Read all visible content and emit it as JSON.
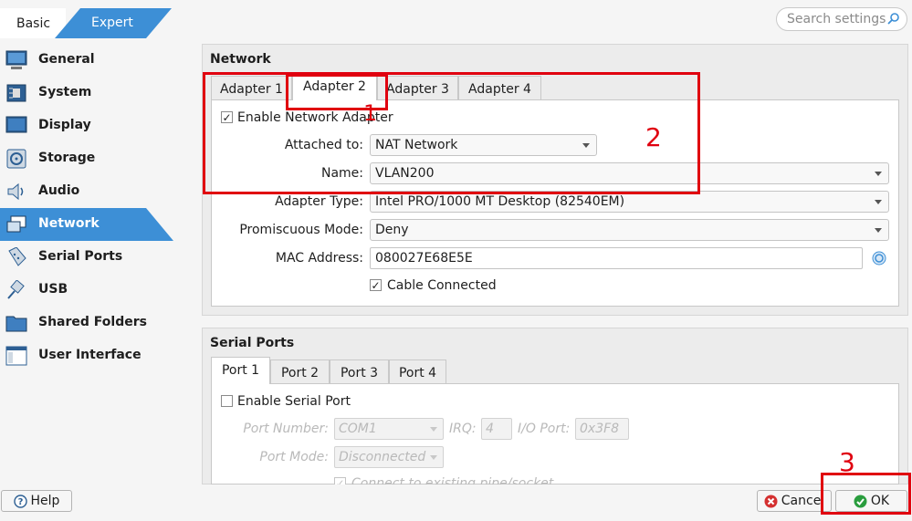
{
  "top_tabs": {
    "basic": "Basic",
    "expert": "Expert"
  },
  "search": {
    "placeholder": "Search settings"
  },
  "sidebar": {
    "items": [
      {
        "label": "General",
        "icon": "monitor-icon"
      },
      {
        "label": "System",
        "icon": "chip-icon"
      },
      {
        "label": "Display",
        "icon": "display-icon"
      },
      {
        "label": "Storage",
        "icon": "disk-icon"
      },
      {
        "label": "Audio",
        "icon": "speaker-icon"
      },
      {
        "label": "Network",
        "icon": "network-icon"
      },
      {
        "label": "Serial Ports",
        "icon": "serial-port-icon"
      },
      {
        "label": "USB",
        "icon": "usb-icon"
      },
      {
        "label": "Shared Folders",
        "icon": "folder-icon"
      },
      {
        "label": "User Interface",
        "icon": "window-icon"
      }
    ],
    "selected": "Network"
  },
  "network": {
    "title": "Network",
    "tabs": [
      "Adapter 1",
      "Adapter 2",
      "Adapter 3",
      "Adapter 4"
    ],
    "selected_tab": "Adapter 2",
    "enable_label": "Enable Network Adapter",
    "enabled": true,
    "attached_label": "Attached to:",
    "attached_value": "NAT Network",
    "name_label": "Name:",
    "name_value": "VLAN200",
    "adapter_type_label": "Adapter Type:",
    "adapter_type_value": "Intel PRO/1000 MT Desktop (82540EM)",
    "promiscuous_label": "Promiscuous Mode:",
    "promiscuous_value": "Deny",
    "mac_label": "MAC Address:",
    "mac_value": "080027E68E5E",
    "cable_label": "Cable Connected",
    "cable_connected": true
  },
  "serial": {
    "title": "Serial Ports",
    "tabs": [
      "Port 1",
      "Port 2",
      "Port 3",
      "Port 4"
    ],
    "selected_tab": "Port 1",
    "enable_label": "Enable Serial Port",
    "port_number_label": "Port Number:",
    "port_number_value": "COM1",
    "irq_label": "IRQ:",
    "irq_value": "4",
    "io_label": "I/O Port:",
    "io_value": "0x3F8",
    "port_mode_label": "Port Mode:",
    "port_mode_value": "Disconnected",
    "connect_label": "Connect to existing pipe/socket"
  },
  "buttons": {
    "help": "Help",
    "cancel": "Cancel",
    "ok": "OK"
  },
  "annotations": [
    "1",
    "2",
    "3"
  ],
  "colors": {
    "accent": "#3d8fd6",
    "annotation": "#e0000f",
    "ok_green": "#2a9d3e",
    "cancel_red": "#d43030"
  }
}
